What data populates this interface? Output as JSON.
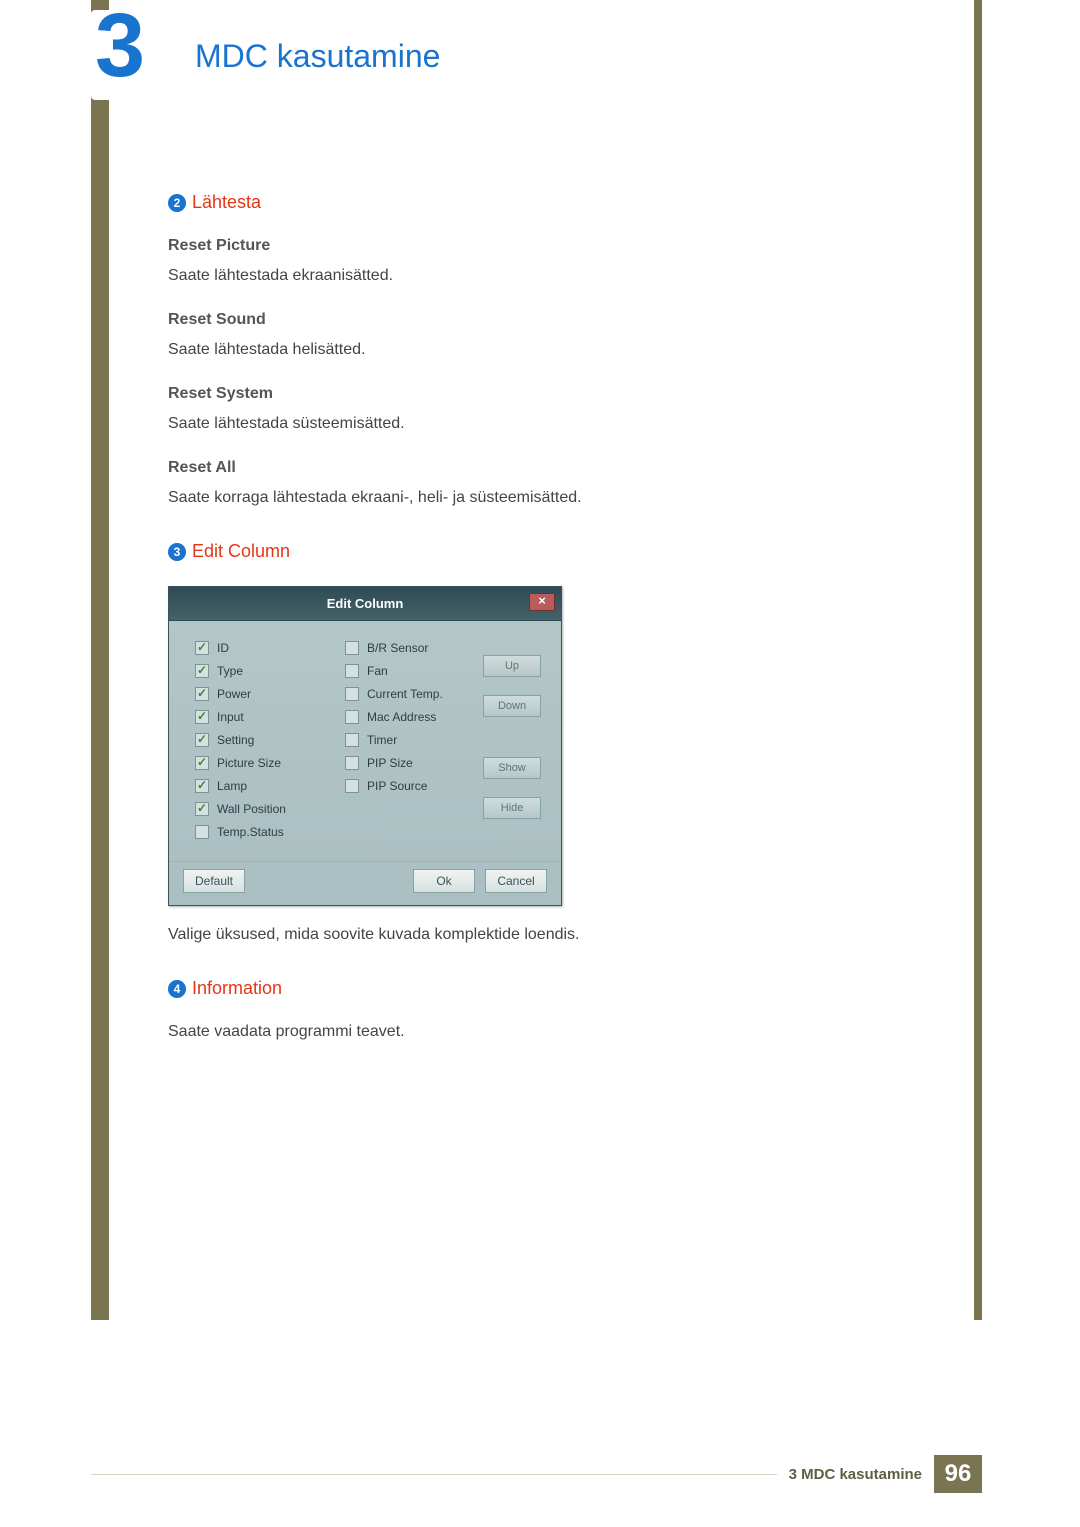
{
  "chapter": {
    "number": "3",
    "title": "MDC kasutamine"
  },
  "section2": {
    "num": "2",
    "title": "Lähtesta",
    "items": [
      {
        "h": "Reset Picture",
        "t": "Saate lähtestada ekraanisätted."
      },
      {
        "h": "Reset Sound",
        "t": "Saate lähtestada helisätted."
      },
      {
        "h": "Reset System",
        "t": "Saate lähtestada süsteemisätted."
      },
      {
        "h": "Reset All",
        "t": "Saate korraga lähtestada ekraani-, heli- ja süsteemisätted."
      }
    ]
  },
  "section3": {
    "num": "3",
    "title": "Edit Column",
    "dialog": {
      "title": "Edit Column",
      "close": "×",
      "col1": [
        {
          "label": "ID",
          "checked": true
        },
        {
          "label": "Type",
          "checked": true
        },
        {
          "label": "Power",
          "checked": true
        },
        {
          "label": "Input",
          "checked": true
        },
        {
          "label": "Setting",
          "checked": true
        },
        {
          "label": "Picture Size",
          "checked": true
        },
        {
          "label": "Lamp",
          "checked": true
        },
        {
          "label": "Wall Position",
          "checked": true
        },
        {
          "label": "Temp.Status",
          "checked": false
        }
      ],
      "col2": [
        {
          "label": "B/R Sensor",
          "checked": false
        },
        {
          "label": "Fan",
          "checked": false
        },
        {
          "label": "Current Temp.",
          "checked": false
        },
        {
          "label": "Mac Address",
          "checked": false
        },
        {
          "label": "Timer",
          "checked": false
        },
        {
          "label": "PIP Size",
          "checked": false
        },
        {
          "label": "PIP Source",
          "checked": false
        }
      ],
      "buttons": {
        "up": "Up",
        "down": "Down",
        "show": "Show",
        "hide": "Hide"
      },
      "footer": {
        "default": "Default",
        "ok": "Ok",
        "cancel": "Cancel"
      }
    },
    "caption": "Valige üksused, mida soovite kuvada komplektide loendis."
  },
  "section4": {
    "num": "4",
    "title": "Information",
    "text": "Saate vaadata programmi teavet."
  },
  "footer": {
    "label": "3 MDC kasutamine",
    "page": "96"
  }
}
